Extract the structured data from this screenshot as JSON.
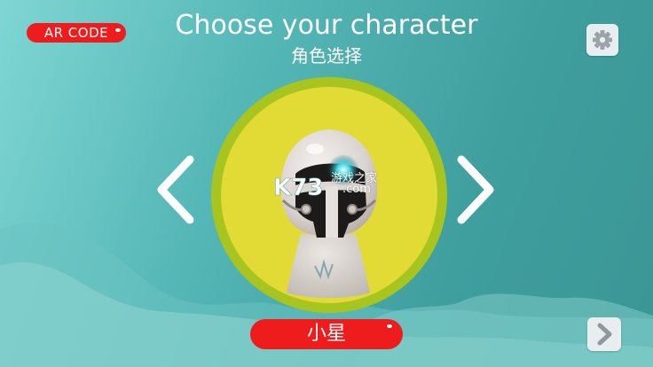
{
  "header": {
    "ar_code_label": "AR CODE",
    "title": "Choose your character",
    "subtitle": "角色选择"
  },
  "character": {
    "name": "小星"
  },
  "watermark": {
    "brand": "K73",
    "text": "游戏之家",
    "domain": ".com"
  },
  "icons": {
    "settings": "gear-icon",
    "prev": "chevron-left-icon",
    "next": "chevron-right-icon",
    "continue": "chevron-right-icon"
  },
  "colors": {
    "accent_red": "#ee1c1c",
    "ring_green": "#a8c41e",
    "disc_yellow": "#e2da35"
  }
}
